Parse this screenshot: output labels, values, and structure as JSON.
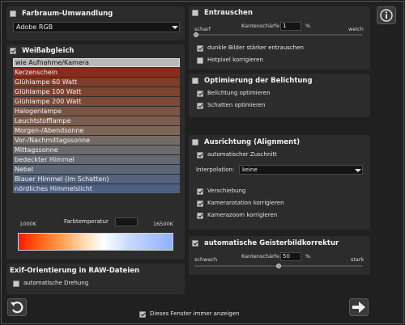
{
  "colorspace": {
    "title": "Farbraum-Umwandlung",
    "checked": false,
    "selected": "Adobe RGB"
  },
  "whitebalance": {
    "title": "Weißabgleich",
    "checked": true,
    "items": [
      {
        "label": "wie Aufnahme/Kamera",
        "color": "#b9b9b9",
        "selected": true
      },
      {
        "label": "Kerzenschein",
        "color": "#8a2a1f"
      },
      {
        "label": "Glühlampe 60 Watt",
        "color": "#7e3c2a"
      },
      {
        "label": "Glühlampe 100 Watt",
        "color": "#7c4330"
      },
      {
        "label": "Glühlampe 200 Watt",
        "color": "#7b4a36"
      },
      {
        "label": "Halogenlampe",
        "color": "#7c5444"
      },
      {
        "label": "Leuchtstofflampe",
        "color": "#7c5e4f"
      },
      {
        "label": "Morgen-/Abendsonne",
        "color": "#7d6658"
      },
      {
        "label": "Vor-/Nachmittagssonne",
        "color": "#736a66"
      },
      {
        "label": "Mittagssonne",
        "color": "#6b6a6d"
      },
      {
        "label": "bedeckter Himmel",
        "color": "#636873"
      },
      {
        "label": "Nebel",
        "color": "#5c6679"
      },
      {
        "label": "Blauer Himmel (im Schatten)",
        "color": "#55627c"
      },
      {
        "label": "nördliches Himmelslicht",
        "color": "#4e5f82"
      }
    ],
    "temp_min": "1000K",
    "temp_label": "Farbtemperatur",
    "temp_max": "16500K",
    "temp_value": ""
  },
  "exif": {
    "title": "Exif-Orientierung in RAW-Dateien",
    "auto_rotate_label": "automatische Drehung",
    "auto_rotate_checked": false
  },
  "noise": {
    "title": "Entrauschen",
    "checked": false,
    "edge_label": "Kantenschärfe",
    "edge_value": "1",
    "unit": "%",
    "left_label": "scharf",
    "right_label": "weich",
    "slider_value_pct": 1,
    "dark_label": "dunkle Bilder stärker entrauschen",
    "dark_checked": true,
    "hotpixel_label": "Hotpixel korrigieren",
    "hotpixel_checked": false
  },
  "exposure": {
    "title": "Optimierung der Belichtung",
    "checked": false,
    "opt_label": "Belichtung optimieren",
    "opt_checked": true,
    "shadow_label": "Schatten optimieren",
    "shadow_checked": true
  },
  "alignment": {
    "title": "Ausrichtung (Alignment)",
    "checked": false,
    "autocrop_label": "automatischer Zuschnitt",
    "autocrop_checked": true,
    "interp_label": "Interpolation:",
    "interp_value": "keine",
    "shift_label": "Verschiebung",
    "shift_checked": true,
    "rotation_label": "Kamerarotation korrigieren",
    "rotation_checked": true,
    "zoom_label": "Kamerazoom korrigieren",
    "zoom_checked": true
  },
  "ghost": {
    "title": "automatische Geisterbildkorrektur",
    "checked": true,
    "edge_label": "Kantenschärfe",
    "edge_value": "50",
    "unit": "%",
    "left_label": "schwach",
    "right_label": "stark",
    "slider_value_pct": 50
  },
  "footer": {
    "show_always_label": "Dieses Fenster immer anzeigen",
    "show_always_checked": true
  },
  "icons": {
    "info": "info-icon",
    "back": "undo-arrow-icon",
    "next": "right-arrow-icon"
  }
}
